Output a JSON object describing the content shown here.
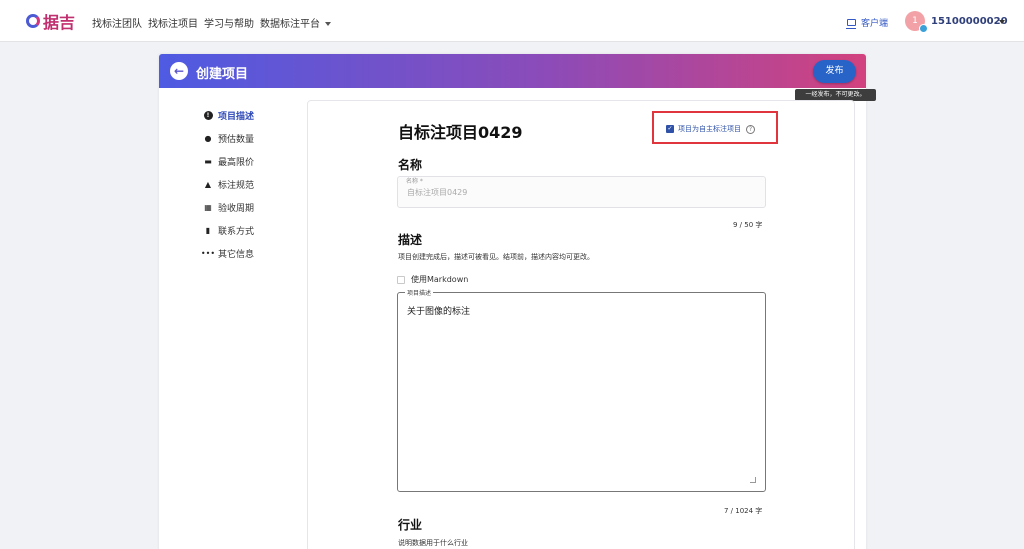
{
  "nav": {
    "logo_text": "据吉",
    "items": [
      "找标注团队",
      "找标注项目",
      "学习与帮助",
      "数据标注平台"
    ],
    "client_label": "客户端",
    "avatar_text": "1",
    "user_phone": "15100000020"
  },
  "header": {
    "title": "创建项目",
    "publish_label": "发布",
    "publish_tooltip": "一经发布，不可更改。"
  },
  "sidebar": {
    "items": [
      {
        "label": "项目描述",
        "icon": "info-icon",
        "active": true
      },
      {
        "label": "预估数量",
        "icon": "bag-icon",
        "active": false
      },
      {
        "label": "最高限价",
        "icon": "price-icon",
        "active": false
      },
      {
        "label": "标注规范",
        "icon": "graduation-cap-icon",
        "active": false
      },
      {
        "label": "验收周期",
        "icon": "calendar-icon",
        "active": false
      },
      {
        "label": "联系方式",
        "icon": "contact-book-icon",
        "active": false
      },
      {
        "label": "其它信息",
        "icon": "more-icon",
        "active": false
      }
    ]
  },
  "form": {
    "title": "自标注项目0429",
    "self_annotate_label": "项目为自主标注项目",
    "self_annotate_checked": true,
    "name_section": {
      "title": "名称",
      "legend": "名称 *",
      "value": "自标注项目0429",
      "counter": "9 / 50 字"
    },
    "desc_section": {
      "title": "描述",
      "hint": "项目创建完成后，描述可被看见。结项前，描述内容均可更改。",
      "markdown_label": "使用Markdown",
      "markdown_checked": false,
      "legend": "项目描述",
      "value": "关于图像的标注",
      "counter": "7 / 1024 字"
    },
    "industry_section": {
      "title": "行业",
      "hint": "说明数据用于什么行业"
    }
  },
  "colors": {
    "gradient_start": "#4e5be2",
    "gradient_end": "#d2427e",
    "primary": "#2863c8",
    "highlight": "#e0353c"
  }
}
